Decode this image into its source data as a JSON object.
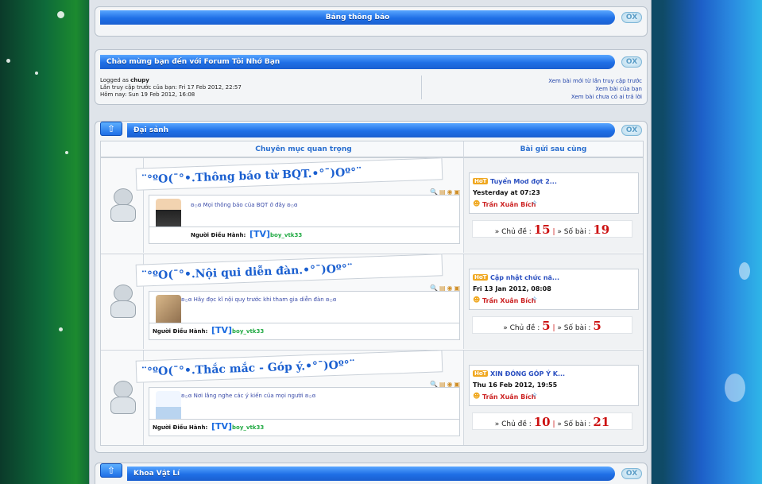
{
  "notice_box": {
    "title": "Bảng thông báo"
  },
  "welcome_box": {
    "title": "Chào mừng bạn đến với Forum Tôi Nhớ Bạn",
    "logged_as_label": "Logged as",
    "username": "chupy",
    "last_visit": "Lần truy cập trước của bạn: Fri 17 Feb 2012, 22:57",
    "today": "Hôm nay: Sun 19 Feb 2012, 16:08",
    "links": [
      "Xem bài mới từ lần truy cập trước",
      "Xem bài của bạn",
      "Xem bài chưa có ai trả lời"
    ]
  },
  "category": {
    "title": "Đại sảnh",
    "col_forum": "Chuyên mục quan trọng",
    "col_last": "Bài gửi sau cùng",
    "forums": [
      {
        "title": "¨°ºO(¯°•.Thông báo từ BQT.•°¯)Oº°¨",
        "desc": "ʚ۞ɞ Mọi thông báo của BQT ở đây ʚ۞ɞ",
        "mod_label": "Người Điều Hành:",
        "mod_tag": "[TV]",
        "mod_name": "boy_vtk33",
        "last_title": "Tuyển Mod đợt 2...",
        "last_date": "Yesterday at 07:23",
        "last_author": "Trần Xuân Bích",
        "topics_label": "» Chủ đề :",
        "topics": "15",
        "posts_label": "» Số bài :",
        "posts": "19"
      },
      {
        "title": "¨°ºO(¯°•.Nội qui diễn đàn.•°¯)Oº°¨",
        "desc": "ʚ۞ɞ Hãy đọc kĩ nội quy trước khi tham gia diễn đàn ʚ۞ɞ",
        "mod_label": "Người Điều Hành:",
        "mod_tag": "[TV]",
        "mod_name": "boy_vtk33",
        "last_title": "Cập nhật chức nă...",
        "last_date": "Fri 13 Jan 2012, 08:08",
        "last_author": "Trần Xuân Bích",
        "topics_label": "» Chủ đề :",
        "topics": "5",
        "posts_label": "» Số bài :",
        "posts": "5"
      },
      {
        "title": "¨°ºO(¯°•.Thắc mắc - Góp ý.•°¯)Oº°¨",
        "desc": "ʚ۞ɞ Nơi lắng nghe các ý kiến của mọi người ʚ۞ɞ",
        "mod_label": "Người Điều Hành:",
        "mod_tag": "[TV]",
        "mod_name": "boy_vtk33",
        "last_title": "XIN ĐÓNG GÓP Ý K...",
        "last_date": "Thu 16 Feb 2012, 19:55",
        "last_author": "Trần Xuân Bích",
        "topics_label": "» Chủ đề :",
        "topics": "10",
        "posts_label": "» Số bài :",
        "posts": "21"
      }
    ]
  },
  "next_category": {
    "title": "Khoa Vật Lí"
  },
  "common": {
    "ox": "OX",
    "hot": "HoT",
    "up_arrow": "⇧"
  }
}
